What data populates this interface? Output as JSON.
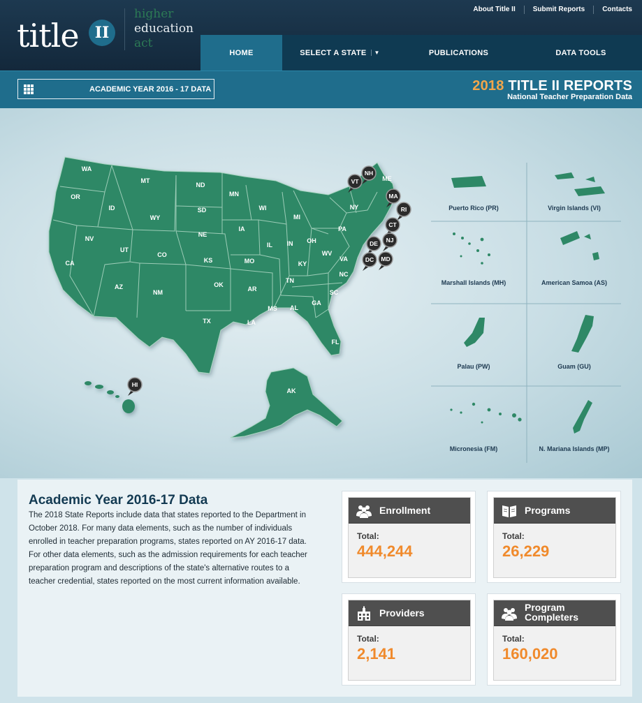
{
  "header": {
    "logo": {
      "word": "title",
      "badge": "II",
      "sub": [
        "higher",
        "education",
        "act"
      ]
    },
    "top_links": [
      "About Title II",
      "Submit Reports",
      "Contacts"
    ],
    "nav": [
      {
        "label": "HOME",
        "active": true
      },
      {
        "label": "SELECT A STATE",
        "active": false
      },
      {
        "label": "PUBLICATIONS",
        "active": false
      },
      {
        "label": "DATA TOOLS",
        "active": false
      }
    ]
  },
  "bar": {
    "year_select": "ACADEMIC YEAR 2016 - 17 DATA",
    "report_year": "2018",
    "report_title": "TITLE II REPORTS",
    "report_subtitle": "National Teacher Preparation Data"
  },
  "map": {
    "state_labels": [
      "WA",
      "OR",
      "CA",
      "NV",
      "ID",
      "MT",
      "WY",
      "UT",
      "AZ",
      "CO",
      "NM",
      "ND",
      "SD",
      "NE",
      "KS",
      "OK",
      "TX",
      "MN",
      "IA",
      "MO",
      "AR",
      "LA",
      "WI",
      "IL",
      "MI",
      "IN",
      "OH",
      "KY",
      "TN",
      "MS",
      "AL",
      "GA",
      "FL",
      "SC",
      "NC",
      "VA",
      "WV",
      "PA",
      "NY",
      "ME",
      "AK"
    ],
    "pins": [
      "VT",
      "NH",
      "MA",
      "RI",
      "CT",
      "NJ",
      "DE",
      "DC",
      "MD",
      "HI"
    ],
    "territories": [
      "Puerto Rico (PR)",
      "Virgin Islands (VI)",
      "Marshall Islands (MH)",
      "American Samoa (AS)",
      "Palau (PW)",
      "Guam (GU)",
      "Micronesia (FM)",
      "N. Mariana Islands (MP)"
    ],
    "colors": {
      "state_fill": "#2e8866",
      "state_stroke": "#a8d4c0",
      "pin": "#2b2b2b"
    }
  },
  "summary": {
    "heading": "Academic Year 2016-17 Data",
    "body": "The 2018 State Reports include data that states reported to the Department in October 2018. For many data elements, such as the number of individuals enrolled in teacher preparation programs, states reported on AY 2016-17 data. For other data elements, such as the admission requirements for each teacher preparation program and descriptions of the state's alternative routes to a teacher credential, states reported on the most current information available."
  },
  "stats": [
    {
      "title": "Enrollment",
      "total_label": "Total:",
      "value": "444,244",
      "icon": "people-icon"
    },
    {
      "title": "Programs",
      "total_label": "Total:",
      "value": "26,229",
      "icon": "book-icon"
    },
    {
      "title": "Providers",
      "total_label": "Total:",
      "value": "2,141",
      "icon": "building-icon"
    },
    {
      "title": "Program Completers",
      "total_label": "Total:",
      "value": "160,020",
      "icon": "people-icon"
    }
  ],
  "accent_colors": {
    "orange": "#f08a2c",
    "teal": "#1f6d8c",
    "navy": "#13283b"
  }
}
